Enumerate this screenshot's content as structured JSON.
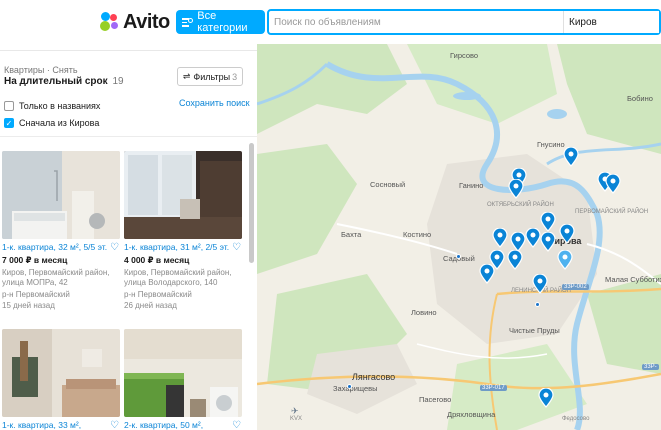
{
  "header": {
    "logo_text": "Avito",
    "categories_label": "Все категории",
    "search_placeholder": "Поиск по объявлениям",
    "city_value": "Киров"
  },
  "panel": {
    "breadcrumb": "Квартиры · Снять",
    "title": "На длительный срок",
    "count": "19",
    "filters_label": "Фильтры",
    "filters_count": "3",
    "only_titles_label": "Только в названиях",
    "only_titles_checked": false,
    "kirov_first_label": "Сначала из Кирова",
    "kirov_first_checked": true,
    "save_search_label": "Сохранить поиск"
  },
  "listings": [
    {
      "name": "1-к. квартира, 32 м², 5/5 эт.",
      "price": "7 000 ₽ в месяц",
      "address": "Киров, Первомайский район, улица МОПРа, 42",
      "district": "р-н Первомайский",
      "date": "15 дней назад"
    },
    {
      "name": "1-к. квартира, 31 м², 2/5 эт.",
      "price": "4 000 ₽ в месяц",
      "address": "Киров, Первомайский район, улица Володарского, 140",
      "district": "р-н Первомайский",
      "date": "26 дней назад"
    },
    {
      "name": "1-к. квартира, 33 м²,",
      "price": "",
      "address": "",
      "district": "",
      "date": ""
    },
    {
      "name": "2-к. квартира, 50 м²,",
      "price": "",
      "address": "",
      "district": "",
      "date": ""
    }
  ],
  "map": {
    "labels": {
      "girsovo": "Гирсово",
      "bobino": "Бобино",
      "gnusino": "Гнусино",
      "sosnovy": "Сосновый",
      "ganino": "Ганино",
      "oktyabrsky": "ОКТЯБРЬСКИЙ РАЙОН",
      "pervomaysky": "ПЕРВОМАЙСКИЙ РАЙОН",
      "bakhta": "Бахта",
      "kostino": "Костино",
      "sadovy": "Садовый",
      "kirov": "Кирова",
      "malaya_subbotikha": "Малая Субботиха",
      "leninsky": "ЛЕНИНСКИЙ РАЙОН",
      "lovino": "Ловино",
      "chistye_prudy": "Чистые Пруды",
      "lyangasovo": "Лянгасово",
      "zakharishchevy": "Захарищевы",
      "pasegovo": "Пасегово",
      "dryakhlovshchina": "Дряхловщина",
      "kvx": "KVX",
      "road_33r002": "33Р-002",
      "road_33r017": "33Р-017",
      "road_33r": "33Р-",
      "fedosovo": "Федосово"
    },
    "colors": {
      "pin": "#0a84d6",
      "pin_light": "#4fb2ef",
      "water": "#a6d2ef",
      "forest": "#cfe6be",
      "urban": "#e6e2da"
    }
  }
}
